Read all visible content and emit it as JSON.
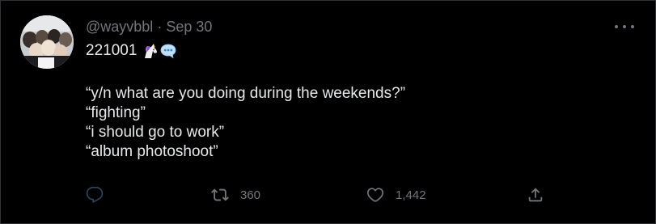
{
  "tweet": {
    "handle": "@wayvbbl",
    "separator": "·",
    "date": "Sep 30",
    "first_line": "221001",
    "emojis": [
      "unicorn-emoji",
      "speech-balloon-emoji"
    ],
    "lines": [
      "“y/n what are you doing during the weekends?”",
      "“fighting”",
      "“i should go to work”",
      "“album photoshoot”"
    ]
  },
  "actions": {
    "reply_icon": "reply-icon",
    "retweet_icon": "retweet-icon",
    "retweet_count": "360",
    "like_icon": "heart-icon",
    "like_count": "1,442",
    "share_icon": "share-icon"
  },
  "colors": {
    "background": "#000000",
    "text": "#e7e9ea",
    "muted": "#71767b"
  }
}
